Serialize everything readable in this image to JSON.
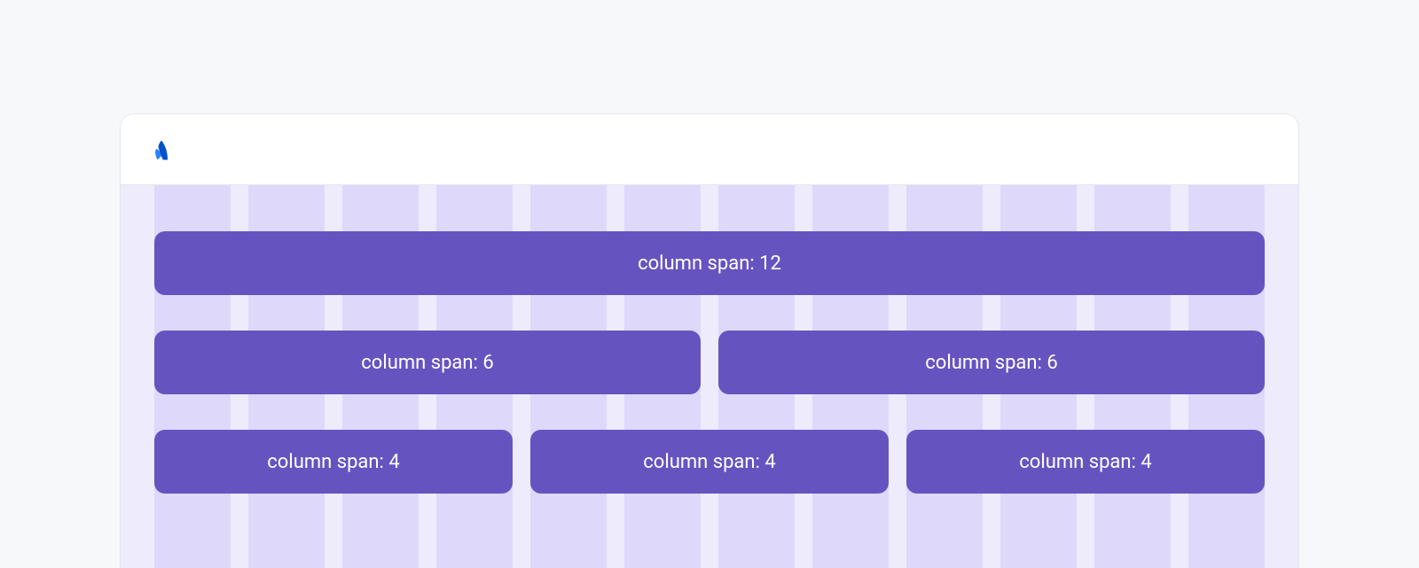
{
  "logo": {
    "name": "atlassian-logo",
    "color": "#0052cc"
  },
  "grid": {
    "columns": 12,
    "rows": [
      {
        "blocks": [
          {
            "span": 12,
            "label": "column span: 12"
          }
        ]
      },
      {
        "blocks": [
          {
            "span": 6,
            "label": "column span: 6"
          },
          {
            "span": 6,
            "label": "column span: 6"
          }
        ]
      },
      {
        "blocks": [
          {
            "span": 4,
            "label": "column span: 4"
          },
          {
            "span": 4,
            "label": "column span: 4"
          },
          {
            "span": 4,
            "label": "column span: 4"
          }
        ]
      }
    ]
  }
}
